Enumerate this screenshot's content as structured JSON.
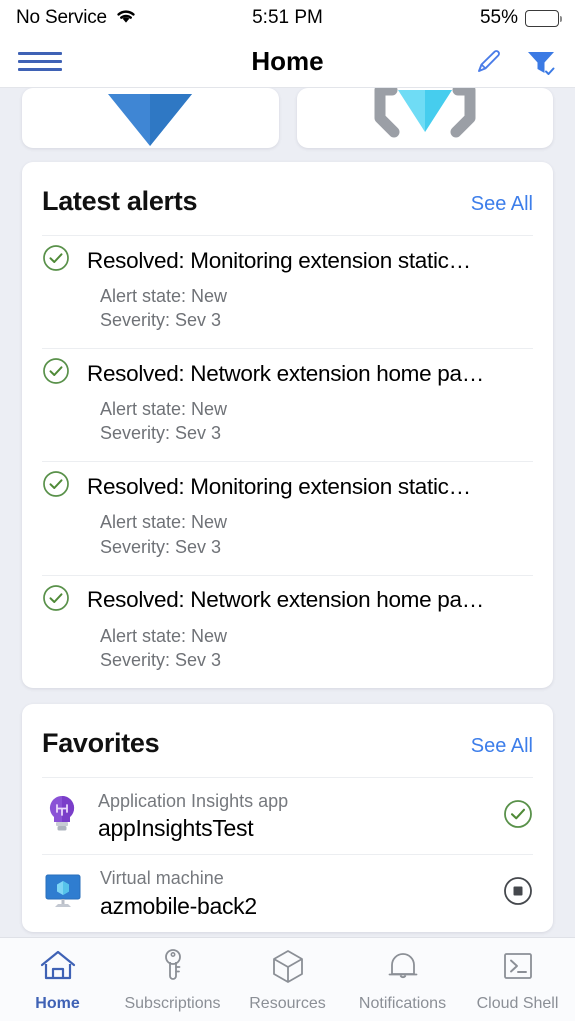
{
  "statusbar": {
    "carrier": "No Service",
    "wifi_icon": "wifi-icon",
    "time": "5:51 PM",
    "battery_percent": "55%",
    "battery_level": 55
  },
  "navbar": {
    "menu_icon": "hamburger-menu-icon",
    "title": "Home",
    "edit_icon": "pencil-icon",
    "filter_icon": "filter-funnel-check-icon"
  },
  "tiles": [
    {
      "name": "azure-tile-blue",
      "icon": "azure-logo-icon",
      "color": "#3f86d4"
    },
    {
      "name": "azure-tile-gem",
      "icon": "gem-brackets-icon",
      "color": "#4fd2f0"
    }
  ],
  "alerts_section": {
    "title": "Latest alerts",
    "see_all": "See All",
    "items": [
      {
        "status_icon": "check-circle-icon",
        "title": "Resolved: Monitoring extension static…",
        "state": "Alert state: New",
        "severity": "Severity: Sev 3"
      },
      {
        "status_icon": "check-circle-icon",
        "title": "Resolved: Network extension home pa…",
        "state": "Alert state: New",
        "severity": "Severity: Sev 3"
      },
      {
        "status_icon": "check-circle-icon",
        "title": "Resolved: Monitoring extension static…",
        "state": "Alert state: New",
        "severity": "Severity: Sev 3"
      },
      {
        "status_icon": "check-circle-icon",
        "title": "Resolved: Network extension home pa…",
        "state": "Alert state: New",
        "severity": "Severity: Sev 3"
      }
    ]
  },
  "favorites_section": {
    "title": "Favorites",
    "see_all": "See All",
    "items": [
      {
        "resource_icon": "application-insights-icon",
        "type": "Application Insights app",
        "name": "appInsightsTest",
        "status_icon": "check-circle-icon"
      },
      {
        "resource_icon": "virtual-machine-icon",
        "type": "Virtual machine",
        "name": "azmobile-back2",
        "status_icon": "stop-circle-icon"
      }
    ]
  },
  "tabbar": {
    "items": [
      {
        "icon": "home-icon",
        "label": "Home",
        "active": true
      },
      {
        "icon": "key-icon",
        "label": "Subscriptions",
        "active": false
      },
      {
        "icon": "cube-icon",
        "label": "Resources",
        "active": false
      },
      {
        "icon": "bell-icon",
        "label": "Notifications",
        "active": false
      },
      {
        "icon": "terminal-icon",
        "label": "Cloud Shell",
        "active": false
      }
    ]
  },
  "colors": {
    "accent_blue": "#3f62b5",
    "link_blue": "#3d7eea",
    "success_green": "#4f8a37",
    "muted_gray": "#76797e",
    "page_bg": "#eceef4"
  }
}
